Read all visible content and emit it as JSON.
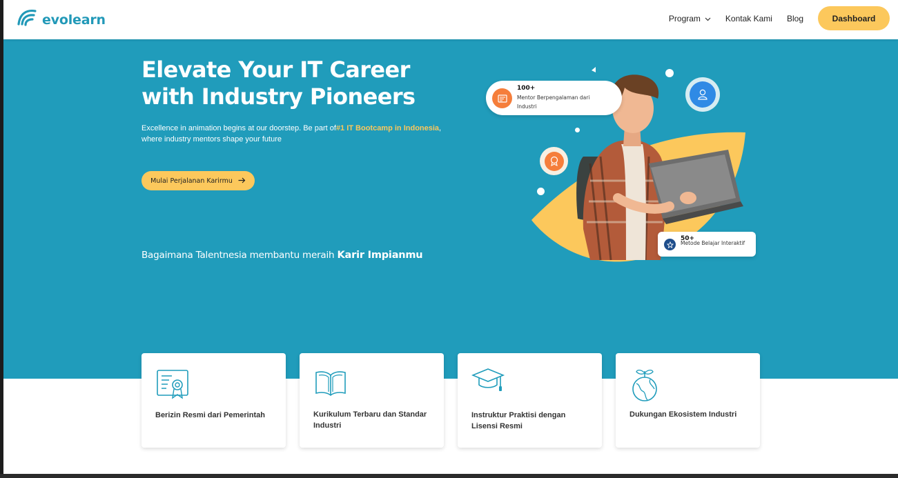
{
  "brand": {
    "name": "evolearn",
    "color": "#2299b8"
  },
  "nav": {
    "items": [
      {
        "label": "Program",
        "has_dropdown": true
      },
      {
        "label": "Kontak Kami",
        "has_dropdown": false
      },
      {
        "label": "Blog",
        "has_dropdown": false
      }
    ],
    "dashboard_label": "Dashboard"
  },
  "hero": {
    "title": "Elevate Your IT Career with Industry Pioneers",
    "description_before": "Excellence in animation begins at our doorstep. Be part of",
    "description_highlight": "#1 IT Bootcamp in Indonesia",
    "description_after": ", where industry mentors shape your future",
    "cta_label": "Mulai Perjalanan Karirmu",
    "sub_heading_prefix": "Bagaimana Talentnesia membantu meraih",
    "sub_heading_bold": "Karir Impianmu",
    "background_color": "#209cbb",
    "accent_color": "#fcc85c"
  },
  "stats": {
    "mentor": {
      "value": "100+",
      "label": "Mentor Berpengalaman dari Industri"
    },
    "metode": {
      "value": "50+",
      "label": "Metode Belajar Interaktif"
    }
  },
  "features": [
    {
      "icon": "certificate-icon",
      "label": "Berizin Resmi dari Pemerintah"
    },
    {
      "icon": "open-book-icon",
      "label": "Kurikulum Terbaru dan Standar Industri"
    },
    {
      "icon": "graduation-cap-icon",
      "label": "Instruktur Praktisi dengan Lisensi Resmi"
    },
    {
      "icon": "globe-plant-icon",
      "label": "Dukungan Ekosistem Industri"
    }
  ]
}
